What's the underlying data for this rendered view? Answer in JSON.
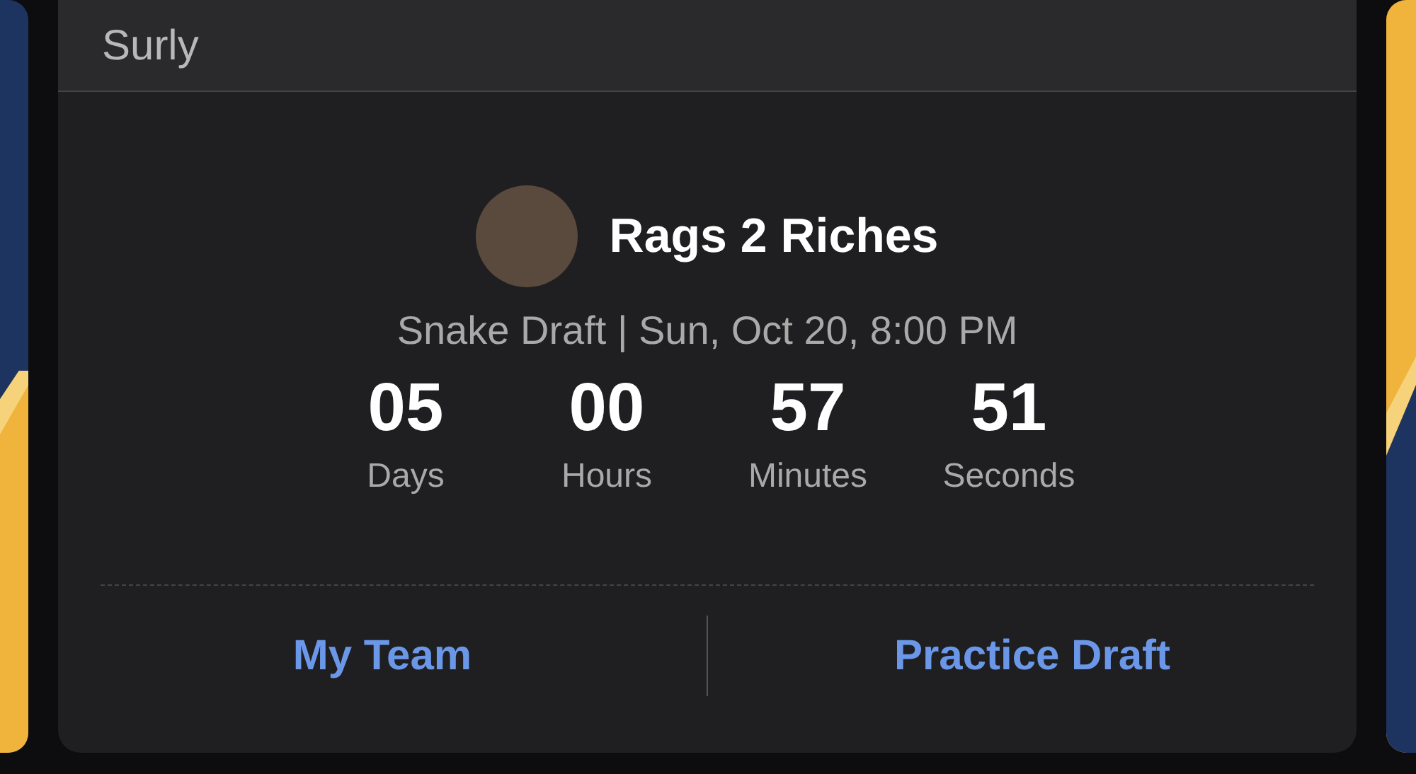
{
  "card": {
    "league": "Surly",
    "team": "Rags 2 Riches",
    "draft_info": "Snake Draft | Sun, Oct 20, 8:00 PM",
    "countdown": [
      {
        "value": "05",
        "unit": "Days"
      },
      {
        "value": "00",
        "unit": "Hours"
      },
      {
        "value": "57",
        "unit": "Minutes"
      },
      {
        "value": "51",
        "unit": "Seconds"
      }
    ],
    "actions": [
      "My Team",
      "Practice Draft"
    ]
  }
}
